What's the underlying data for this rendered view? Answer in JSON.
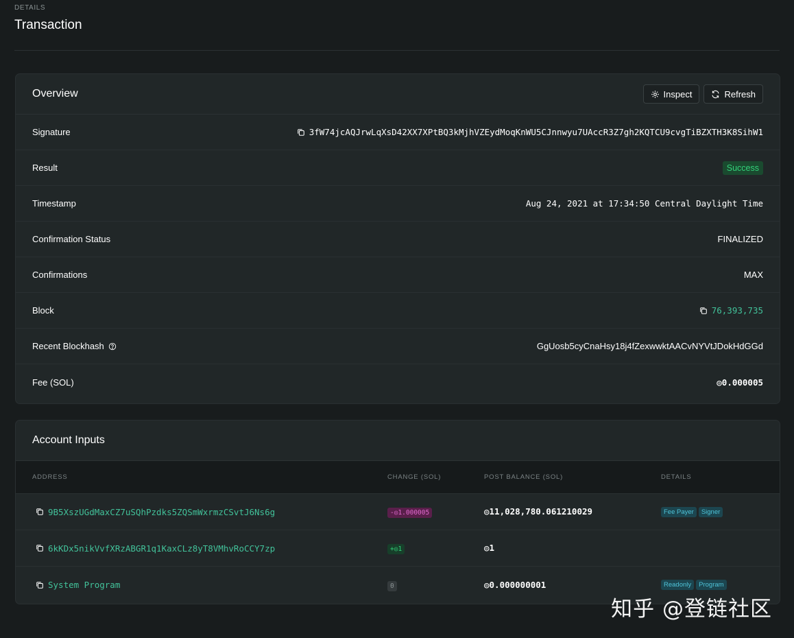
{
  "header": {
    "pretitle": "DETAILS",
    "title": "Transaction"
  },
  "overview": {
    "title": "Overview",
    "buttons": {
      "inspect": "Inspect",
      "refresh": "Refresh"
    },
    "rows": {
      "signature": {
        "label": "Signature",
        "value": "3fW74jcAQJrwLqXsD42XX7XPtBQ3kMjhVZEydMoqKnWU5CJnnwyu7UAccR3Z7gh2KQTCU9cvgTiBZXTH3K8SihW1"
      },
      "result": {
        "label": "Result",
        "value": "Success"
      },
      "timestamp": {
        "label": "Timestamp",
        "value": "Aug 24, 2021 at 17:34:50 Central Daylight Time"
      },
      "confirmation_status": {
        "label": "Confirmation Status",
        "value": "FINALIZED"
      },
      "confirmations": {
        "label": "Confirmations",
        "value": "MAX"
      },
      "block": {
        "label": "Block",
        "value": "76,393,735"
      },
      "recent_blockhash": {
        "label": "Recent Blockhash",
        "value": "GgUosb5cyCnaHsy18j4fZexwwktAACvNYVtJDokHdGGd"
      },
      "fee": {
        "label": "Fee (SOL)",
        "value": "◎0.000005"
      }
    }
  },
  "account_inputs": {
    "title": "Account Inputs",
    "columns": {
      "address": "ADDRESS",
      "change": "CHANGE (SOL)",
      "post_balance": "POST BALANCE (SOL)",
      "details": "DETAILS"
    },
    "rows": [
      {
        "address": "9B5XszUGdMaxCZ7uSQhPzdks5ZQSmWxrmzCSvtJ6Ns6g",
        "change": "-◎1.000005",
        "post_balance": "◎11,028,780.061210029",
        "tags": [
          "Fee Payer",
          "Signer"
        ]
      },
      {
        "address": "6kKDx5nikVvfXRzABGR1q1KaxCLz8yT8VMhvRoCCY7zp",
        "change": "+◎1",
        "post_balance": "◎1",
        "tags": []
      },
      {
        "address": "System Program",
        "change": "0",
        "post_balance": "◎0.000000001",
        "tags": [
          "Readonly",
          "Program"
        ]
      }
    ]
  },
  "watermark": "知乎 @登链社区",
  "colors": {
    "background": "#181c1d",
    "card": "#212728",
    "link": "#42c29a",
    "success": "#33d17a",
    "negative": "#e26bd0",
    "tag": "#4fc3d8"
  }
}
